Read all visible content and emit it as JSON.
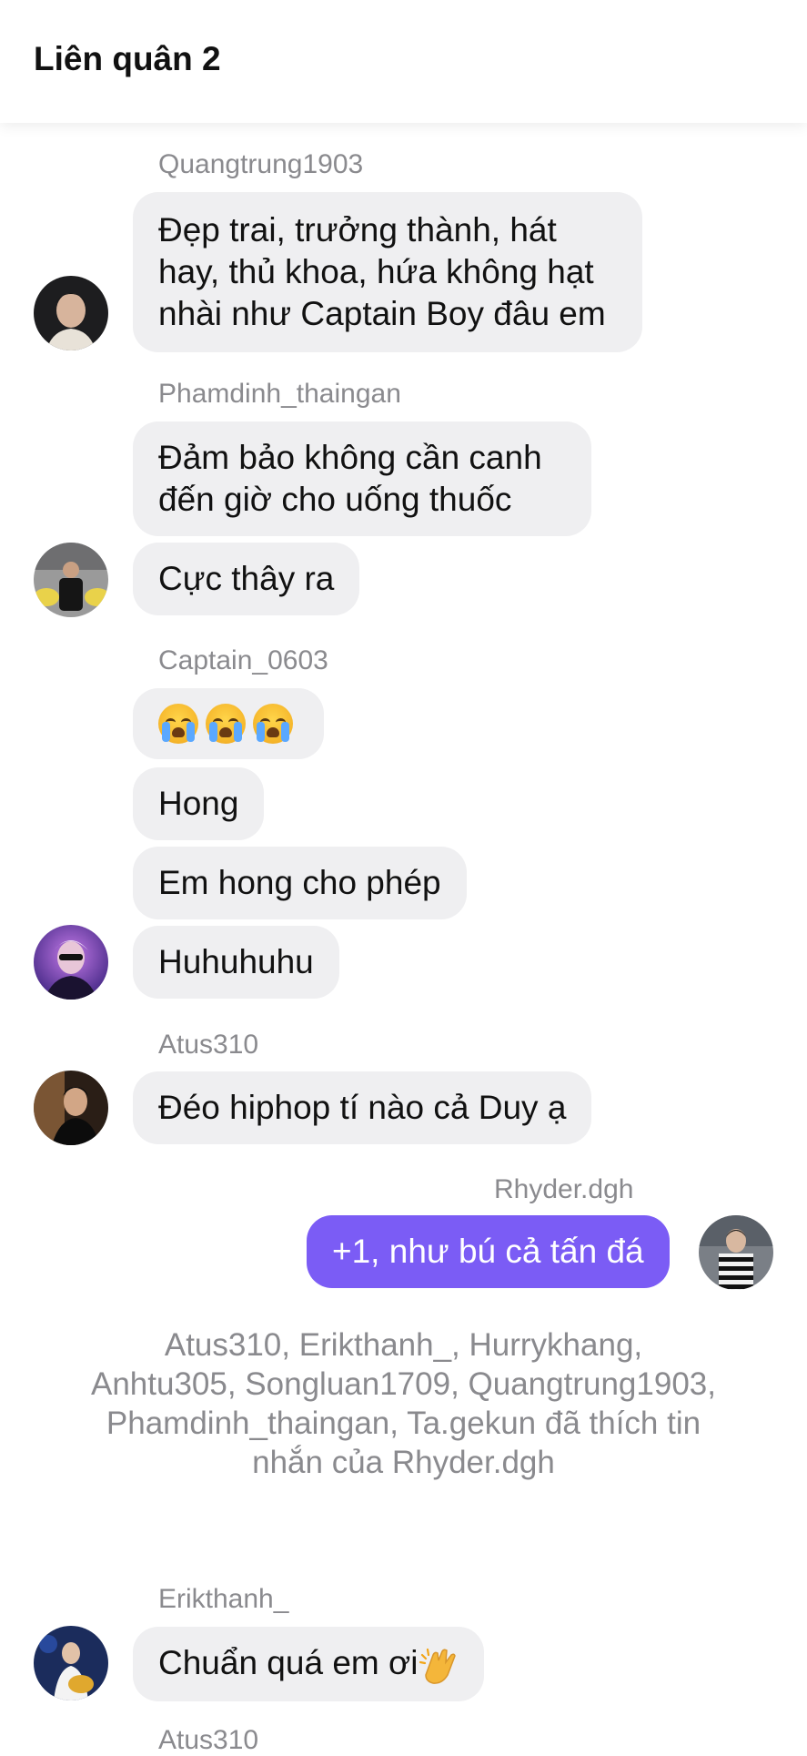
{
  "header": {
    "title": "Liên quân 2"
  },
  "messages": {
    "quang": {
      "sender": "Quangtrung1903",
      "lines": [
        "Đẹp trai, trưởng thành, hát",
        "hay, thủ khoa, hứa không hạt",
        "nhài như Captain Boy đâu em"
      ]
    },
    "pham": {
      "sender": "Phamdinh_thaingan",
      "line1": "Đảm bảo không cần canh",
      "line2": "đến giờ cho uống thuốc",
      "line3": "Cực thây ra"
    },
    "captain": {
      "sender": "Captain_0603",
      "emoji_icon": "crying-face-icon",
      "msg2": "Hong",
      "msg3": "Em hong cho phép",
      "msg4": "Huhuhuhu"
    },
    "atus": {
      "sender": "Atus310",
      "msg": "Đéo hiphop tí nào cả Duy ạ"
    },
    "rhyder": {
      "sender": "Rhyder.dgh",
      "msg": "+1, như bú cả tấn đá"
    },
    "likes_text": "Atus310, Erikthanh_, Hurrykhang, Anhtu305, Songluan1709, Quangtrung1903, Phamdinh_thaingan, Ta.gekun đã thích tin nhắn của Rhyder.dgh",
    "erik": {
      "sender": "Erikthanh_",
      "msg": "Chuẩn quá em ơi",
      "emoji_icon": "clapping-hands-icon"
    },
    "atus2": {
      "sender": "Atus310"
    }
  },
  "colors": {
    "bubble_other": "#efeff1",
    "bubble_me": "#7b5cf5",
    "sender_text": "#8a8a8e"
  }
}
